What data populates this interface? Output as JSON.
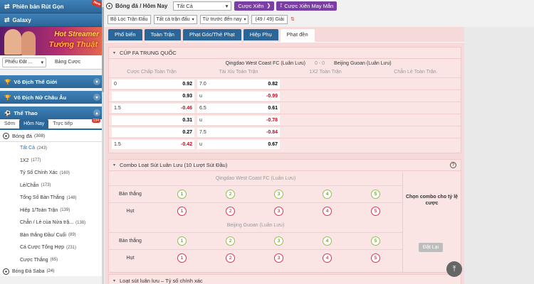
{
  "sidebar": {
    "banner1": "Phiên bản Rút Gọn",
    "banner1_badge": "New",
    "banner2": "Galaxy",
    "promo": {
      "line1": "Hot Streamer",
      "line2": "Tướng Thuật"
    },
    "odds_type": "Phiếu Đặt ...",
    "bet_table_link": "Bảng Cược",
    "sections": [
      {
        "label": "Vô Địch Thế Giới"
      },
      {
        "label": "Vô Địch Nữ Châu Âu"
      },
      {
        "label": "Thể Thao"
      }
    ],
    "subtabs": [
      "Sớm",
      "Hôm Nay",
      "Trực tiếp"
    ],
    "live_badge": "134",
    "sport": {
      "label": "Bóng đá",
      "count": "(308)"
    },
    "items": [
      {
        "label": "Tất Cả",
        "count": "(243)"
      },
      {
        "label": "1X2",
        "count": "(177)"
      },
      {
        "label": "Tỷ Số Chính Xác",
        "count": "(160)"
      },
      {
        "label": "Lẻ/Chẵn",
        "count": "(173)"
      },
      {
        "label": "Tổng Số Bàn Thắng",
        "count": "(148)"
      },
      {
        "label": "Hiệp 1/Toàn Trận",
        "count": "(139)"
      },
      {
        "label": "Chẵn / Lẻ của Nửa trậ...",
        "count": "(138)"
      },
      {
        "label": "Bàn thắng Đầu/ Cuối",
        "count": "(89)"
      },
      {
        "label": "Cá Cược Tổng Hợp",
        "count": "(231)"
      },
      {
        "label": "Cược Thắng",
        "count": "(65)"
      }
    ],
    "sport2": {
      "label": "Bóng Đá Saba",
      "count": "(24)"
    }
  },
  "topbar": {
    "breadcrumb": "Bóng đá / Hôm Nay",
    "filter": "Tất Cả",
    "btn_parlay": "Cược Xiên",
    "btn_parlay_lucky": "Cược Xiên May Mắn",
    "league_filter": "Bộ Lọc Trận Đấu",
    "all_matches": "Tất cả trận đấu",
    "sort": "Từ trước đến nay",
    "league_count": "(49 / 49) Giải"
  },
  "tabs": [
    "Phổ biến",
    "Toàn Trận",
    "Phạt Góc/Thẻ Phạt",
    "Hiệp Phụ",
    "Phạt đền"
  ],
  "active_tab": 4,
  "match": {
    "league": "CÚP FA TRUNG QUỐC",
    "home": "Qingdao West Coast FC (Luân Lưu)",
    "score": "0 - 0",
    "away": "Beijing Guoan (Luân Lưu)",
    "col_heads": [
      "Cược Chấp Toàn Trận",
      "Tài Xỉu Toàn Trận",
      "1X2 Toàn Trận",
      "Chẵn Lẻ Toàn Trận"
    ],
    "rows": [
      {
        "h_hdp": "0",
        "h_odds": "0.92",
        "ou_line": "7.0",
        "ou_odds": "0.82"
      },
      {
        "h_hdp": "",
        "h_odds": "0.93",
        "ou_line": "u",
        "ou_odds": "-0.99"
      },
      {
        "h_hdp": "1.5",
        "h_odds": "-0.46",
        "ou_line": "6.5",
        "ou_odds": "0.61"
      },
      {
        "h_hdp": "",
        "h_odds": "0.31",
        "ou_line": "u",
        "ou_odds": "-0.78"
      },
      {
        "h_hdp": "",
        "h_odds": "0.27",
        "ou_line": "7.5",
        "ou_odds": "-0.84"
      },
      {
        "h_hdp": "1.5",
        "h_odds": "-0.42",
        "ou_line": "u",
        "ou_odds": "0.67"
      }
    ]
  },
  "combo": {
    "title": "Combo Loạt Sút Luân Lưu (10 Lượt Sút Đầu)",
    "team1": "Qingdao West Coast FC (Luân Lưu)",
    "team2": "Beijing Guoan (Luân Lưu)",
    "scored": "Bàn thắng",
    "missed": "Hụt",
    "numbers": [
      "1",
      "2",
      "3",
      "4",
      "5"
    ],
    "side_text": "Chọn combo cho tỷ lệ cược",
    "reset": "Đặt Lại"
  },
  "next_section": "Loạt sút luân lưu – Tỷ số chính xác"
}
